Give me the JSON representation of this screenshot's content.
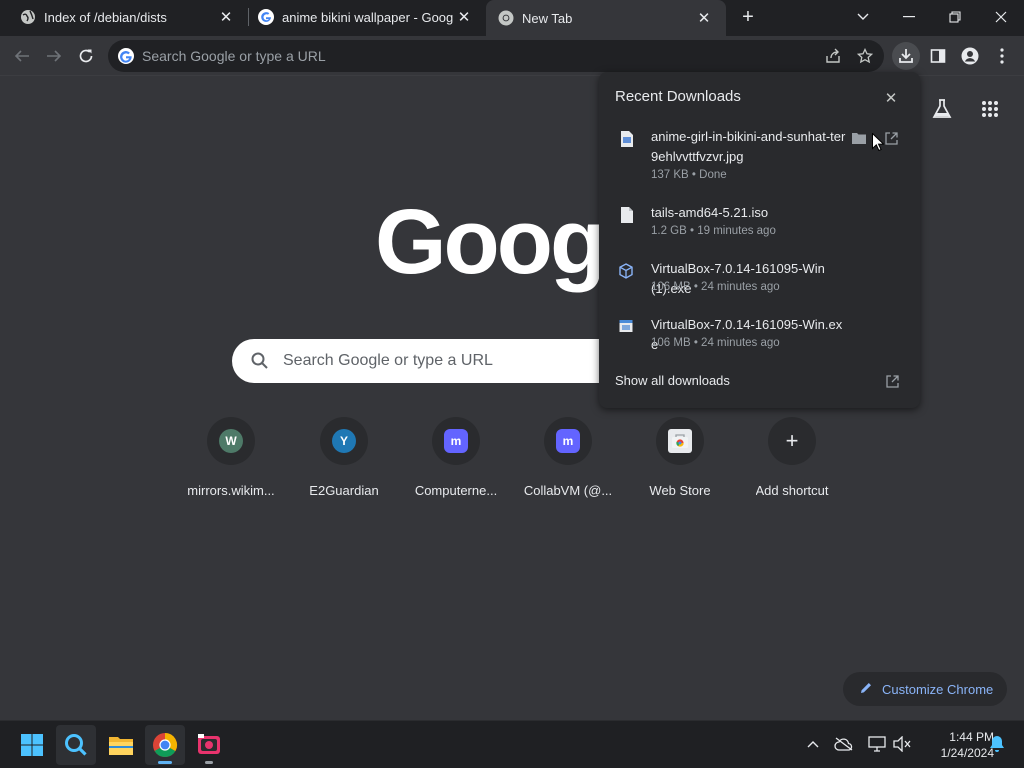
{
  "tabs": [
    {
      "title": "Index of /debian/dists",
      "favicon": "globe-icon",
      "active": false
    },
    {
      "title": "anime bikini wallpaper - Google S",
      "favicon": "google-g-icon",
      "active": false
    },
    {
      "title": "New Tab",
      "favicon": "chrome-icon",
      "active": true
    }
  ],
  "omnibox": {
    "placeholder": "Search Google or type a URL"
  },
  "ntp": {
    "logo_text": "Googl",
    "search_placeholder": "Search Google or type a URL",
    "shortcuts": [
      {
        "label": "mirrors.wikim...",
        "letter": "W",
        "color": "#4e7a68"
      },
      {
        "label": "E2Guardian",
        "letter": "Y",
        "color": "#1f78b4"
      },
      {
        "label": "Computerne...",
        "letter": "m",
        "color": "#6364ff"
      },
      {
        "label": "CollabVM (@...",
        "letter": "m",
        "color": "#6364ff"
      },
      {
        "label": "Web Store",
        "letter": "",
        "color": "#e8eaed"
      },
      {
        "label": "Add shortcut",
        "letter": "+",
        "color": ""
      }
    ],
    "customize_label": "Customize Chrome"
  },
  "downloads": {
    "title": "Recent Downloads",
    "items": [
      {
        "name": "anime-girl-in-bikini-and-sunhat-ter9ehlvvttfvzvr.jpg",
        "meta": "137 KB • Done",
        "icon": "image-file-icon"
      },
      {
        "name": "tails-amd64-5.21.iso",
        "meta": "1.2 GB • 19 minutes ago",
        "icon": "file-icon"
      },
      {
        "name": "VirtualBox-7.0.14-161095-Win (1).exe",
        "meta": "106 MB • 24 minutes ago",
        "icon": "virtualbox-icon"
      },
      {
        "name": "VirtualBox-7.0.14-161095-Win.exe",
        "meta": "106 MB • 24 minutes ago",
        "icon": "installer-icon"
      }
    ],
    "show_all": "Show all downloads"
  },
  "taskbar": {
    "time": "1:44 PM",
    "date": "1/24/2024"
  },
  "colors": {
    "background": "#35363a",
    "frame": "#202124",
    "bubble": "#292a2d",
    "accent": "#8ab4f8"
  }
}
